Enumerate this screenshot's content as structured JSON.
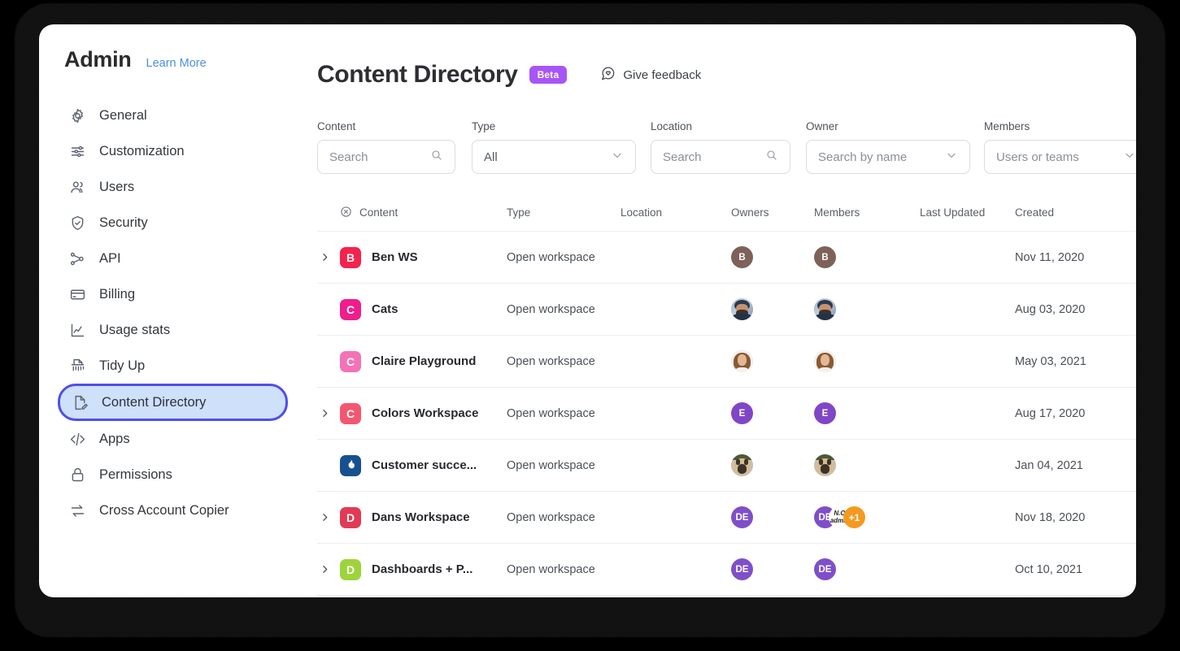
{
  "sidebar": {
    "brand": "Admin",
    "learn_more": "Learn More",
    "items": [
      {
        "label": "General",
        "icon": "gear-icon"
      },
      {
        "label": "Customization",
        "icon": "sliders-icon"
      },
      {
        "label": "Users",
        "icon": "users-icon"
      },
      {
        "label": "Security",
        "icon": "shield-check-icon"
      },
      {
        "label": "API",
        "icon": "nodes-icon"
      },
      {
        "label": "Billing",
        "icon": "credit-card-icon"
      },
      {
        "label": "Usage stats",
        "icon": "chart-line-icon"
      },
      {
        "label": "Tidy Up",
        "icon": "shredder-icon"
      },
      {
        "label": "Content Directory",
        "icon": "document-edit-icon",
        "active": true
      },
      {
        "label": "Apps",
        "icon": "code-icon"
      },
      {
        "label": "Permissions",
        "icon": "lock-icon"
      },
      {
        "label": "Cross Account Copier",
        "icon": "transfer-icon"
      }
    ]
  },
  "header": {
    "title": "Content Directory",
    "badge": "Beta",
    "feedback_label": "Give feedback",
    "feedback_icon": "speech-heart-icon",
    "badge_color": "#a855f7"
  },
  "filters": [
    {
      "label": "Content",
      "value": "Search",
      "control": "search",
      "name": "content-filter"
    },
    {
      "label": "Type",
      "value": "All",
      "control": "select",
      "name": "type-filter",
      "selected_dark": true
    },
    {
      "label": "Location",
      "value": "Search",
      "control": "search",
      "name": "location-filter"
    },
    {
      "label": "Owner",
      "value": "Search by name",
      "control": "select",
      "name": "owner-filter"
    },
    {
      "label": "Members",
      "value": "Users or teams",
      "control": "select",
      "name": "members-filter"
    }
  ],
  "table": {
    "clear_icon": "circle-x-icon",
    "columns": [
      "Content",
      "Type",
      "Location",
      "Owners",
      "Members",
      "Last Updated",
      "Created"
    ],
    "rows": [
      {
        "expandable": true,
        "name": "Ben WS",
        "icon_letter": "B",
        "icon_color": "#f5224e",
        "type": "Open workspace",
        "location": "",
        "last_updated": "",
        "created": "Nov 11, 2020",
        "owners": [
          {
            "kind": "initials",
            "text": "B",
            "color": "#7d6259"
          }
        ],
        "members": [
          {
            "kind": "initials",
            "text": "B",
            "color": "#7d6259"
          }
        ]
      },
      {
        "expandable": false,
        "name": "Cats",
        "icon_letter": "C",
        "icon_color": "#ef1d8d",
        "type": "Open workspace",
        "location": "",
        "last_updated": "",
        "created": "Aug 03, 2020",
        "owners": [
          {
            "kind": "photo",
            "photo": "man-beard"
          }
        ],
        "members": [
          {
            "kind": "photo",
            "photo": "man-beard"
          }
        ]
      },
      {
        "expandable": false,
        "name": "Claire Playground",
        "icon_letter": "C",
        "icon_color": "#f472b6",
        "type": "Open workspace",
        "location": "",
        "last_updated": "",
        "created": "May 03, 2021",
        "owners": [
          {
            "kind": "photo",
            "photo": "woman-brunette"
          }
        ],
        "members": [
          {
            "kind": "photo",
            "photo": "woman-brunette"
          }
        ]
      },
      {
        "expandable": true,
        "name": "Colors Workspace",
        "icon_letter": "C",
        "icon_color": "#f4566f",
        "type": "Open workspace",
        "location": "",
        "last_updated": "",
        "created": "Aug 17, 2020",
        "owners": [
          {
            "kind": "initials",
            "text": "E",
            "color": "#8046c6"
          }
        ],
        "members": [
          {
            "kind": "initials",
            "text": "E",
            "color": "#8046c6"
          }
        ]
      },
      {
        "expandable": false,
        "name": "Customer succe...",
        "icon_letter": "",
        "icon_color": "#16518f",
        "icon_glyph": "flame-icon",
        "type": "Open workspace",
        "location": "",
        "last_updated": "",
        "created": "Jan 04, 2021",
        "owners": [
          {
            "kind": "photo",
            "photo": "pug-dog"
          }
        ],
        "members": [
          {
            "kind": "photo",
            "photo": "pug-dog"
          }
        ]
      },
      {
        "expandable": true,
        "name": "Dans Workspace",
        "icon_letter": "D",
        "icon_color": "#e23a54",
        "type": "Open workspace",
        "location": "",
        "last_updated": "",
        "created": "Nov 18, 2020",
        "owners": [
          {
            "kind": "initials",
            "text": "DE",
            "color": "#7f4fc9"
          }
        ],
        "members": [
          {
            "kind": "initials",
            "text": "DE",
            "color": "#7f4fc9"
          },
          {
            "kind": "label",
            "text": "N.O admin",
            "color": "#ffffff"
          },
          {
            "kind": "more",
            "text": "+1",
            "color": "#f59a1f"
          }
        ]
      },
      {
        "expandable": true,
        "name": "Dashboards + P...",
        "icon_letter": "D",
        "icon_color": "#9ed43b",
        "type": "Open workspace",
        "location": "",
        "last_updated": "",
        "created": "Oct 10, 2021",
        "owners": [
          {
            "kind": "initials",
            "text": "DE",
            "color": "#7f4fc9"
          }
        ],
        "members": [
          {
            "kind": "initials",
            "text": "DE",
            "color": "#7f4fc9"
          }
        ]
      }
    ]
  }
}
